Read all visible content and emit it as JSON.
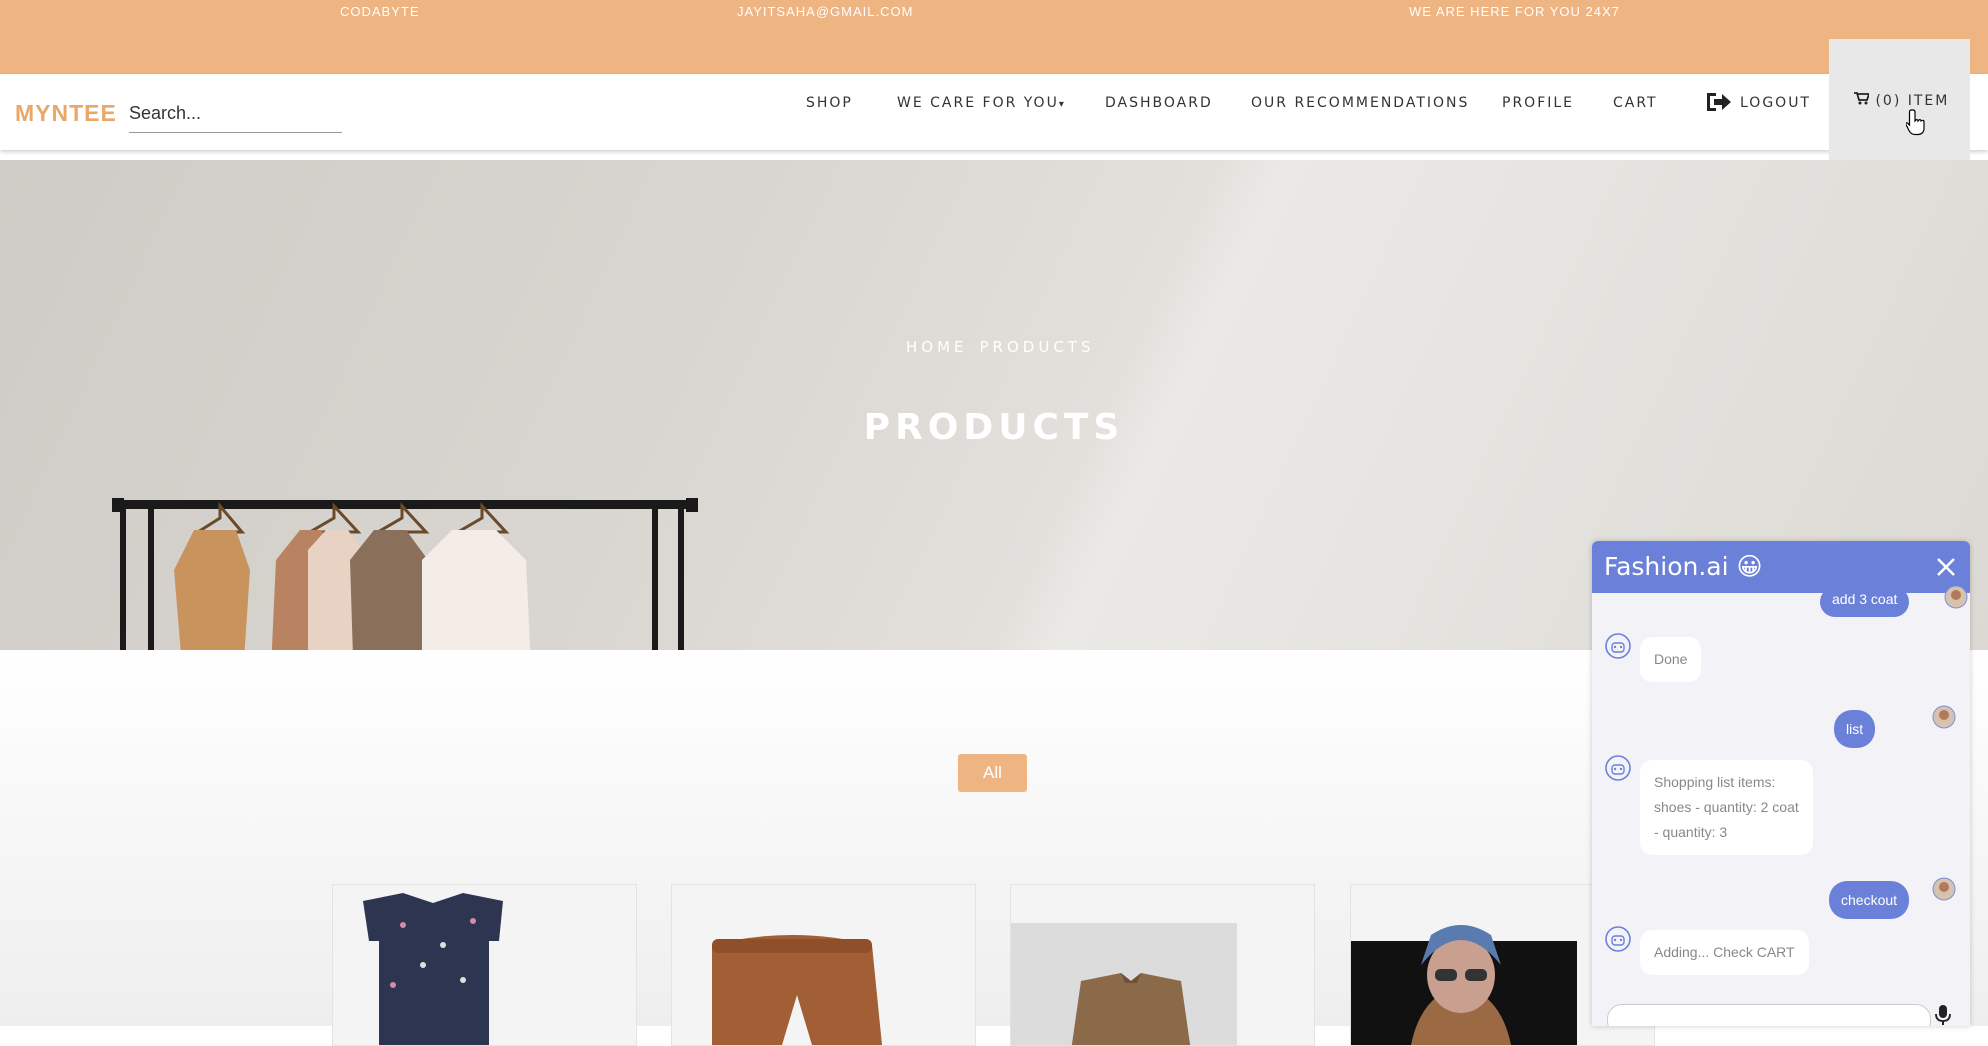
{
  "topbar": {
    "brand": "CODABYTE",
    "email": "JAYITSAHA@GMAIL.COM",
    "support": "WE ARE HERE FOR YOU 24X7"
  },
  "nav": {
    "logo": "MYNTEE",
    "search_placeholder": "Search...",
    "items": [
      "SHOP",
      "WE CARE FOR YOU",
      "DASHBOARD",
      "OUR RECOMMENDATIONS",
      "PROFILE",
      "CART"
    ],
    "logout": "LOGOUT",
    "cart_link": "(0) ITEM"
  },
  "hero": {
    "breadcrumb": [
      "HOME",
      "PRODUCTS"
    ],
    "title": "PRODUCTS"
  },
  "filter": {
    "all_label": "All"
  },
  "chat": {
    "title": "Fashion.ai 😀",
    "messages": [
      {
        "from": "user",
        "text": "add 3 coat"
      },
      {
        "from": "bot",
        "text": "Done"
      },
      {
        "from": "user",
        "text": "list"
      },
      {
        "from": "bot",
        "lines": [
          "Shopping list items:",
          "shoes - quantity: 2 coat",
          "- quantity: 3"
        ]
      },
      {
        "from": "user",
        "text": "checkout"
      },
      {
        "from": "bot",
        "text": "Adding... Check CART"
      }
    ]
  },
  "colors": {
    "accent": "#eeb482",
    "logo": "#e8a86c",
    "chat_primary": "#6b80d8"
  }
}
